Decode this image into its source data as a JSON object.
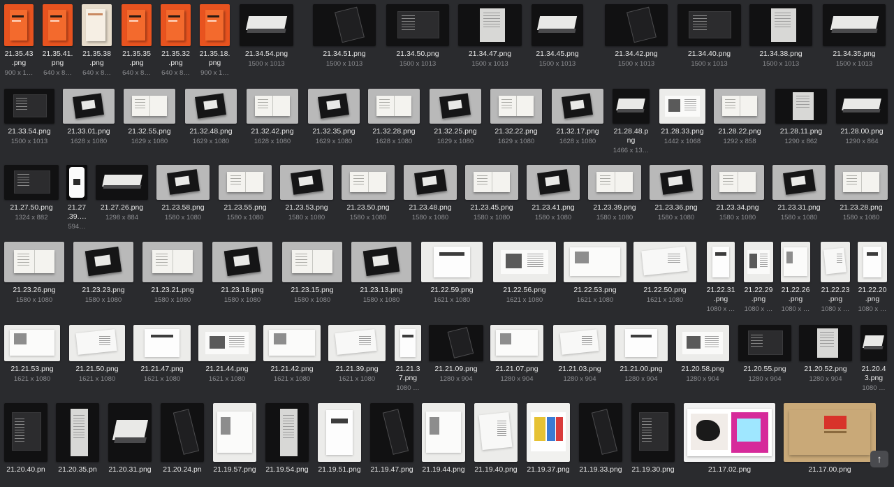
{
  "rows": [
    {
      "items": [
        {
          "name": "21.35.43\n.png",
          "dims": "900 x 1…",
          "tone": "orange"
        },
        {
          "name": "21.35.41.\npng",
          "dims": "640 x 8…",
          "tone": "orange"
        },
        {
          "name": "21.35.38\n.png",
          "dims": "640 x 8…",
          "tone": "cream"
        },
        {
          "name": "21.35.35\n.png",
          "dims": "640 x 8…",
          "tone": "orange"
        },
        {
          "name": "21.35.32\n.png",
          "dims": "640 x 8…",
          "tone": "orange"
        },
        {
          "name": "21.35.18.\npng",
          "dims": "900 x 1…",
          "tone": "orange"
        },
        {
          "name": "21.34.54.png",
          "dims": "1500 x 1013",
          "tone": "dark"
        },
        {
          "name": "21.34.51.png",
          "dims": "1500 x 1013",
          "tone": "dark"
        },
        {
          "name": "21.34.50.png",
          "dims": "1500 x 1013",
          "tone": "dark"
        },
        {
          "name": "21.34.47.png",
          "dims": "1500 x 1013",
          "tone": "dark"
        },
        {
          "name": "21.34.45.png",
          "dims": "1500 x 1013",
          "tone": "dark"
        },
        {
          "name": "21.34.42.png",
          "dims": "1500 x 1013",
          "tone": "dark"
        },
        {
          "name": "21.34.40.png",
          "dims": "1500 x 1013",
          "tone": "dark"
        },
        {
          "name": "21.34.38.png",
          "dims": "1500 x 1013",
          "tone": "dark"
        },
        {
          "name": "21.34.35.png",
          "dims": "1500 x 1013",
          "tone": "dark"
        }
      ]
    },
    {
      "items": [
        {
          "name": "21.33.54.png",
          "dims": "1500 x 1013",
          "tone": "dark"
        },
        {
          "name": "21.33.01.png",
          "dims": "1628 x 1080",
          "tone": "grey"
        },
        {
          "name": "21.32.55.png",
          "dims": "1629 x 1080",
          "tone": "grey"
        },
        {
          "name": "21.32.48.png",
          "dims": "1629 x 1080",
          "tone": "grey"
        },
        {
          "name": "21.32.42.png",
          "dims": "1628 x 1080",
          "tone": "grey"
        },
        {
          "name": "21.32.35.png",
          "dims": "1629 x 1080",
          "tone": "grey"
        },
        {
          "name": "21.32.28.png",
          "dims": "1628 x 1080",
          "tone": "grey"
        },
        {
          "name": "21.32.25.png",
          "dims": "1629 x 1080",
          "tone": "grey"
        },
        {
          "name": "21.32.22.png",
          "dims": "1629 x 1080",
          "tone": "grey"
        },
        {
          "name": "21.32.17.png",
          "dims": "1628 x 1080",
          "tone": "grey"
        },
        {
          "name": "21.28.48.p\nng",
          "dims": "1466 x 13…",
          "tone": "dark"
        },
        {
          "name": "21.28.33.png",
          "dims": "1442 x 1068",
          "tone": "white"
        },
        {
          "name": "21.28.22.png",
          "dims": "1292 x 858",
          "tone": "grey"
        },
        {
          "name": "21.28.11.png",
          "dims": "1290 x 862",
          "tone": "dark"
        },
        {
          "name": "21.28.00.png",
          "dims": "1290 x 864",
          "tone": "dark"
        }
      ]
    },
    {
      "items": [
        {
          "name": "21.27.50.png",
          "dims": "1324 x 882",
          "tone": "dark"
        },
        {
          "name": "21.27\n.39.…",
          "dims": "594…",
          "tone": "phone"
        },
        {
          "name": "21.27.26.png",
          "dims": "1298 x 884",
          "tone": "dark"
        },
        {
          "name": "21.23.58.png",
          "dims": "1580 x 1080",
          "tone": "grey"
        },
        {
          "name": "21.23.55.png",
          "dims": "1580 x 1080",
          "tone": "grey"
        },
        {
          "name": "21.23.53.png",
          "dims": "1580 x 1080",
          "tone": "grey"
        },
        {
          "name": "21.23.50.png",
          "dims": "1580 x 1080",
          "tone": "grey"
        },
        {
          "name": "21.23.48.png",
          "dims": "1580 x 1080",
          "tone": "grey"
        },
        {
          "name": "21.23.45.png",
          "dims": "1580 x 1080",
          "tone": "grey"
        },
        {
          "name": "21.23.41.png",
          "dims": "1580 x 1080",
          "tone": "grey"
        },
        {
          "name": "21.23.39.png",
          "dims": "1580 x 1080",
          "tone": "grey"
        },
        {
          "name": "21.23.36.png",
          "dims": "1580 x 1080",
          "tone": "grey"
        },
        {
          "name": "21.23.34.png",
          "dims": "1580 x 1080",
          "tone": "grey"
        },
        {
          "name": "21.23.31.png",
          "dims": "1580 x 1080",
          "tone": "grey"
        },
        {
          "name": "21.23.28.png",
          "dims": "1580 x 1080",
          "tone": "grey"
        }
      ]
    },
    {
      "items": [
        {
          "name": "21.23.26.png",
          "dims": "1580 x 1080",
          "tone": "grey"
        },
        {
          "name": "21.23.23.png",
          "dims": "1580 x 1080",
          "tone": "grey"
        },
        {
          "name": "21.23.21.png",
          "dims": "1580 x 1080",
          "tone": "grey"
        },
        {
          "name": "21.23.18.png",
          "dims": "1580 x 1080",
          "tone": "grey"
        },
        {
          "name": "21.23.15.png",
          "dims": "1580 x 1080",
          "tone": "grey"
        },
        {
          "name": "21.23.13.png",
          "dims": "1580 x 1080",
          "tone": "grey"
        },
        {
          "name": "21.22.59.png",
          "dims": "1621 x 1080",
          "tone": "white"
        },
        {
          "name": "21.22.56.png",
          "dims": "1621 x 1080",
          "tone": "white"
        },
        {
          "name": "21.22.53.png",
          "dims": "1621 x 1080",
          "tone": "white"
        },
        {
          "name": "21.22.50.png",
          "dims": "1621 x 1080",
          "tone": "white"
        },
        {
          "name": "21.22.31\n.png",
          "dims": "1080 x …",
          "tone": "white"
        },
        {
          "name": "21.22.29\n.png",
          "dims": "1080 x …",
          "tone": "white"
        },
        {
          "name": "21.22.26\n.png",
          "dims": "1080 x …",
          "tone": "white"
        },
        {
          "name": "21.22.23\n.png",
          "dims": "1080 x …",
          "tone": "white"
        },
        {
          "name": "21.22.20\n.png",
          "dims": "1080 x …",
          "tone": "white"
        }
      ]
    },
    {
      "items": [
        {
          "name": "21.21.53.png",
          "dims": "1621 x 1080",
          "tone": "white"
        },
        {
          "name": "21.21.50.png",
          "dims": "1621 x 1080",
          "tone": "white"
        },
        {
          "name": "21.21.47.png",
          "dims": "1621 x 1080",
          "tone": "white"
        },
        {
          "name": "21.21.44.png",
          "dims": "1621 x 1080",
          "tone": "white"
        },
        {
          "name": "21.21.42.png",
          "dims": "1621 x 1080",
          "tone": "white"
        },
        {
          "name": "21.21.39.png",
          "dims": "1621 x 1080",
          "tone": "white"
        },
        {
          "name": "21.21.3\n7.png",
          "dims": "1080 …",
          "tone": "white"
        },
        {
          "name": "21.21.09.png",
          "dims": "1280 x 904",
          "tone": "dark"
        },
        {
          "name": "21.21.07.png",
          "dims": "1280 x 904",
          "tone": "white"
        },
        {
          "name": "21.21.03.png",
          "dims": "1280 x 904",
          "tone": "white"
        },
        {
          "name": "21.21.00.png",
          "dims": "1280 x 904",
          "tone": "white"
        },
        {
          "name": "21.20.58.png",
          "dims": "1280 x 904",
          "tone": "white"
        },
        {
          "name": "21.20.55.png",
          "dims": "1280 x 904",
          "tone": "dark"
        },
        {
          "name": "21.20.52.png",
          "dims": "1280 x 904",
          "tone": "dark"
        },
        {
          "name": "21.20.4\n3.png",
          "dims": "1080 …",
          "tone": "dark"
        }
      ]
    },
    {
      "items": [
        {
          "name": "21.20.40.pn",
          "dims": "",
          "tone": "dark"
        },
        {
          "name": "21.20.35.pn",
          "dims": "",
          "tone": "dark"
        },
        {
          "name": "21.20.31.png",
          "dims": "",
          "tone": "dark"
        },
        {
          "name": "21.20.24.pn",
          "dims": "",
          "tone": "dark"
        },
        {
          "name": "21.19.57.png",
          "dims": "",
          "tone": "white"
        },
        {
          "name": "21.19.54.png",
          "dims": "",
          "tone": "dark"
        },
        {
          "name": "21.19.51.png",
          "dims": "",
          "tone": "white"
        },
        {
          "name": "21.19.47.png",
          "dims": "",
          "tone": "dark"
        },
        {
          "name": "21.19.44.png",
          "dims": "",
          "tone": "white"
        },
        {
          "name": "21.19.40.png",
          "dims": "",
          "tone": "white"
        },
        {
          "name": "21.19.37.png",
          "dims": "",
          "tone": "color"
        },
        {
          "name": "21.19.33.png",
          "dims": "",
          "tone": "dark"
        },
        {
          "name": "21.19.30.png",
          "dims": "",
          "tone": "dark"
        },
        {
          "name": "21.17.02.png",
          "dims": "",
          "tone": "magenta"
        },
        {
          "name": "21.17.00.png",
          "dims": "",
          "tone": "kraft"
        }
      ]
    }
  ],
  "colors": {
    "background": "#2a2b2e",
    "orange": "#e8531f",
    "dark": "#111112",
    "grey": "#b9b9b9",
    "white": "#ececea",
    "cream": "#e7dccb",
    "kraft": "#c9a978",
    "magenta": "#d62a9a"
  },
  "scroll_top": {
    "icon": "arrow-up-icon",
    "glyph": "↑"
  }
}
